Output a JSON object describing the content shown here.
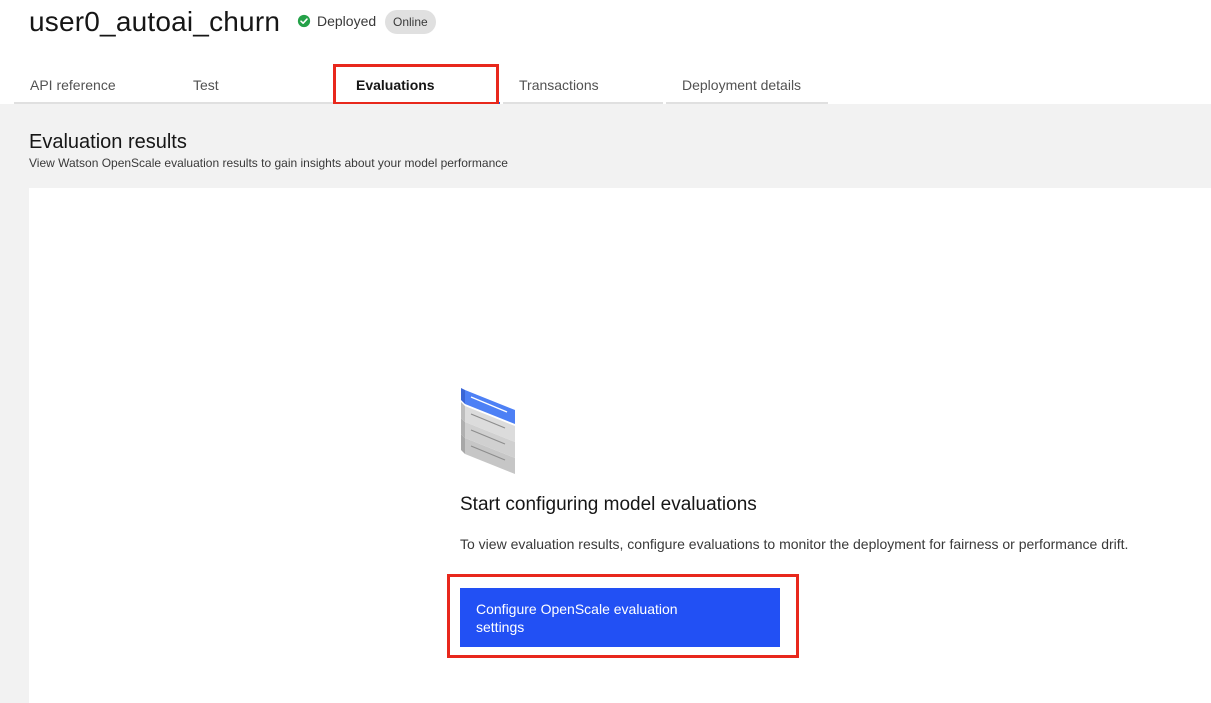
{
  "header": {
    "title": "user0_autoai_churn",
    "status_text": "Deployed",
    "status_color": "#24a148",
    "badge": "Online"
  },
  "tabs": [
    {
      "label": "API reference",
      "active": false
    },
    {
      "label": "Test",
      "active": false
    },
    {
      "label": "Evaluations",
      "active": true
    },
    {
      "label": "Transactions",
      "active": false
    },
    {
      "label": "Deployment details",
      "active": false
    }
  ],
  "section": {
    "title": "Evaluation results",
    "subtitle": "View Watson OpenScale evaluation results to gain insights about your model performance"
  },
  "empty_state": {
    "icon": "stacked-documents-illustration",
    "title": "Start configuring model evaluations",
    "description": "To view evaluation results, configure evaluations to monitor the deployment for fairness or performance drift.",
    "button_label": "Configure OpenScale evaluation settings"
  },
  "colors": {
    "accent": "#2250f4",
    "highlight": "#e8281c",
    "tab_active": "#0f62fe"
  }
}
